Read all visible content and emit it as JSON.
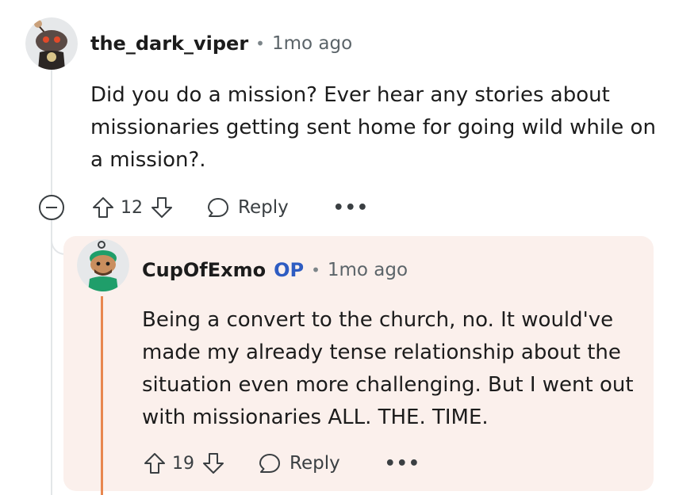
{
  "comment": {
    "username": "the_dark_viper",
    "separator": "•",
    "time": "1mo ago",
    "body": "Did you do a mission? Ever hear any stories about missionaries getting sent home for going wild while on a mission?.",
    "votes": "12",
    "reply_label": "Reply",
    "more_label": "•••",
    "avatar_icon": "snoo-avatar-icon",
    "collapse_icon": "collapse-minus-icon"
  },
  "reply": {
    "username": "CupOfExmo",
    "op_badge": "OP",
    "separator": "•",
    "time": "1mo ago",
    "body": "Being a convert to the church, no. It would've made my already tense relationship about the situation even more challenging. But I went out with missionaries ALL. THE. TIME.",
    "votes": "19",
    "reply_label": "Reply",
    "more_label": "•••",
    "avatar_icon": "snoo-avatar-icon"
  },
  "colors": {
    "op_accent": "#2e5cc2",
    "op_bar": "#e8874f",
    "reply_background": "#fbf0ec",
    "text": "#1c1c1c",
    "muted": "#5b6469"
  }
}
